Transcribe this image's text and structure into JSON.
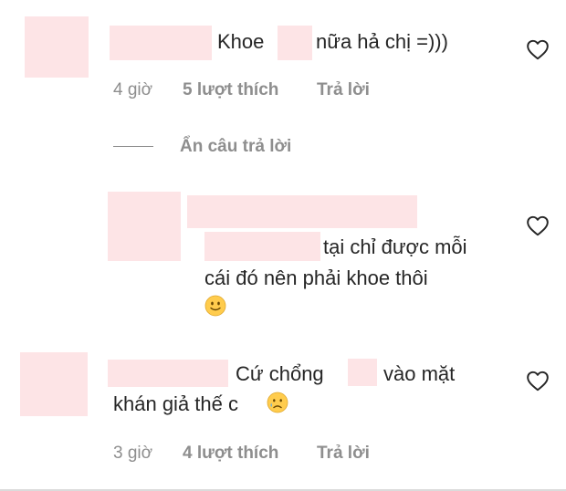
{
  "comment1": {
    "text_a": "Khoe",
    "text_b": "nữa hả chị =)))",
    "time": "4 giờ",
    "likes": "5 lượt thích",
    "reply": "Trả lời"
  },
  "replies_toggle": {
    "label": "Ẩn câu trả lời"
  },
  "reply1": {
    "line1": "tại chỉ được mỗi",
    "line2": "cái đó nên phải khoe thôi",
    "emoji": "slightly-smiling-face"
  },
  "comment2": {
    "text_a": "Cứ chổng",
    "text_b": "vào mặt",
    "line2": "khán giả thế c",
    "emoji": "crying-face",
    "time": "3 giờ",
    "likes": "4 lượt thích",
    "reply": "Trả lời"
  },
  "colors": {
    "redaction": "#fde4e6",
    "text": "#262626",
    "meta": "#8e8e8e"
  },
  "icons": {
    "like": "heart-outline-icon"
  }
}
